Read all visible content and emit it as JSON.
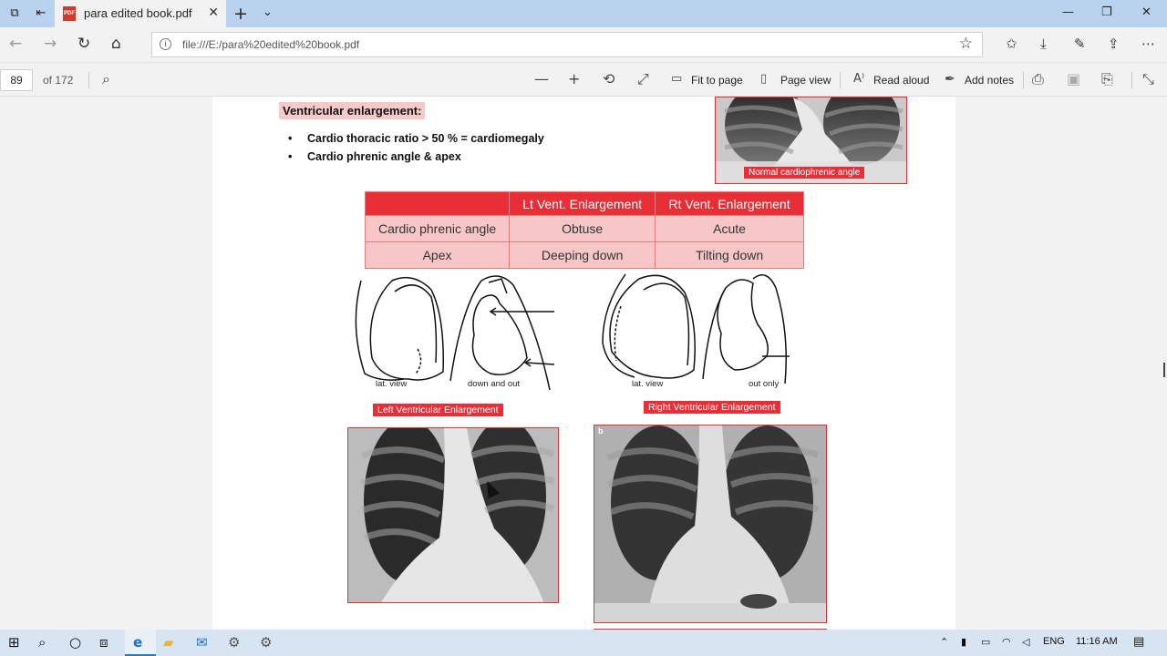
{
  "browser": {
    "tab_title": "para edited book.pdf",
    "url": "file:///E:/para%20edited%20book.pdf"
  },
  "pdf_toolbar": {
    "page_number": "89",
    "page_total": "of 172",
    "fit_to_page": "Fit to page",
    "page_view": "Page view",
    "read_aloud": "Read aloud",
    "add_notes": "Add notes"
  },
  "document": {
    "heading": "Ventricular enlargement:",
    "bullets": [
      "Cardio thoracic ratio  > 50 % = cardiomegaly",
      "Cardio phrenic angle & apex"
    ],
    "top_image_caption": "Normal cardiophrenic angle",
    "table": {
      "headers": [
        "",
        "Lt Vent. Enlargement",
        "Rt Vent. Enlargement"
      ],
      "rows": [
        [
          "Cardio phrenic angle",
          "Obtuse",
          "Acute"
        ],
        [
          "Apex",
          "Deeping down",
          "Tilting down"
        ]
      ]
    },
    "left_sketch": {
      "lat_label": "lat. view",
      "pa_label": "down and out",
      "caption": "Left Ventricular Enlargement"
    },
    "right_sketch": {
      "lat_label": "lat. view",
      "pa_label": "out only",
      "caption": "Right Ventricular Enlargement",
      "xray_corner_mark": "b"
    }
  },
  "taskbar": {
    "language": "ENG",
    "time": "11:16 AM"
  }
}
